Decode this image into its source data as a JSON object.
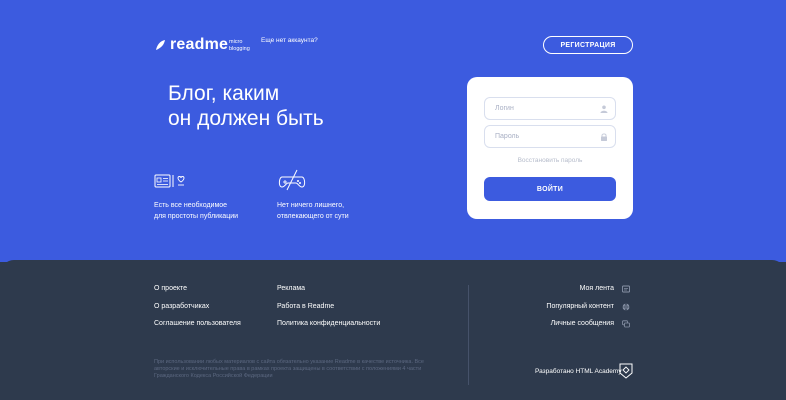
{
  "header": {
    "logo": "readme",
    "logo_sub_1": "micro",
    "logo_sub_2": "blogging",
    "no_account": "Еще нет аккаунта?",
    "register_label": "РЕГИСТРАЦИЯ"
  },
  "hero": {
    "headline_1": "Блог, каким",
    "headline_2": "он должен быть",
    "features": [
      {
        "line1": "Есть все необходимое",
        "line2": "для простоты публикации",
        "icon": "publish-tools-icon"
      },
      {
        "line1": "Нет ничего лишнего,",
        "line2": "отвлекающего от сути",
        "icon": "no-games-icon"
      }
    ]
  },
  "login": {
    "login_placeholder": "Логин",
    "password_placeholder": "Пароль",
    "restore_label": "Восстановить пароль",
    "submit_label": "ВОЙТИ"
  },
  "footer": {
    "col1": [
      "О проекте",
      "О разработчиках",
      "Соглашение пользователя"
    ],
    "col2": [
      "Реклама",
      "Работа в Readme",
      "Политика конфиденциальности"
    ],
    "right": [
      {
        "label": "Моя лента",
        "icon": "feed-icon"
      },
      {
        "label": "Популярный контент",
        "icon": "globe-icon"
      },
      {
        "label": "Личные сообщения",
        "icon": "messages-icon"
      }
    ],
    "copyright": "При использовании любых материалов с сайта обязательно указание Readme в качестве источника. Все авторские и исключительные права в рамках проекта защищены в соответствии с положениями 4 части Гражданского Кодекса Российской Федерации",
    "developed_by": "Разработано HTML Academy"
  },
  "colors": {
    "brand": "#3c5bdf",
    "footer_bg": "#2e3a4d"
  }
}
